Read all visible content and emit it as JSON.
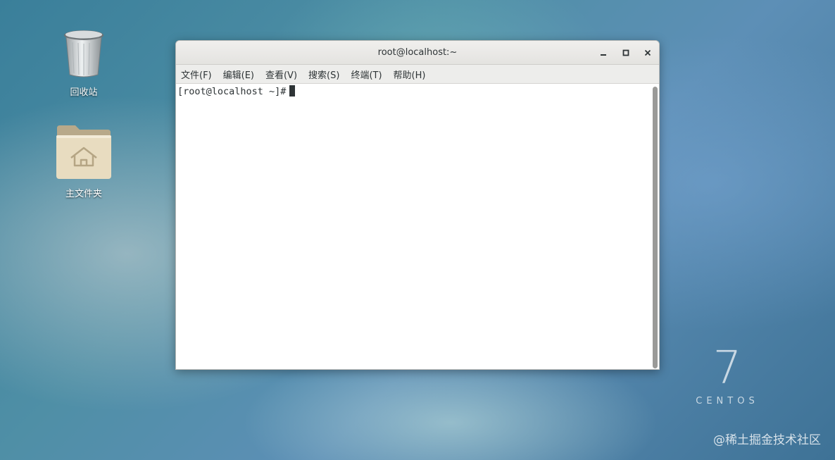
{
  "desktop": {
    "icons": [
      {
        "label": "回收站",
        "icon": "trash-icon"
      },
      {
        "label": "主文件夹",
        "icon": "home-folder-icon"
      }
    ]
  },
  "window": {
    "title": "root@localhost:~",
    "controls": {
      "minimize": "_",
      "maximize": "□",
      "close": "×"
    },
    "menu": [
      "文件(F)",
      "编辑(E)",
      "查看(V)",
      "搜索(S)",
      "终端(T)",
      "帮助(H)"
    ],
    "terminal": {
      "prompt": "[root@localhost ~]#"
    }
  },
  "branding": {
    "version": "7",
    "name": "CENTOS"
  },
  "watermark": "@稀土掘金技术社区",
  "colors": {
    "titlebar": "#e8e7e4",
    "menubar": "#ededeb",
    "terminal_bg": "#ffffff",
    "text": "#2e3436"
  }
}
